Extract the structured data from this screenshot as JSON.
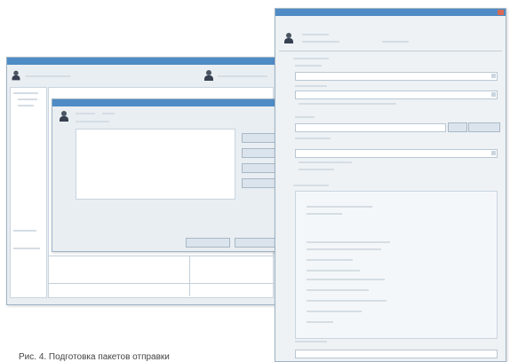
{
  "caption": "Рис. 4. Подготовка пакетов отправки",
  "colors": {
    "titlebar": "#4f8bc4",
    "close_button": "#d96b55",
    "window_bg": "#e9eef2"
  },
  "icons": [
    "user-icon",
    "close-icon",
    "dropdown-arrow-icon"
  ]
}
